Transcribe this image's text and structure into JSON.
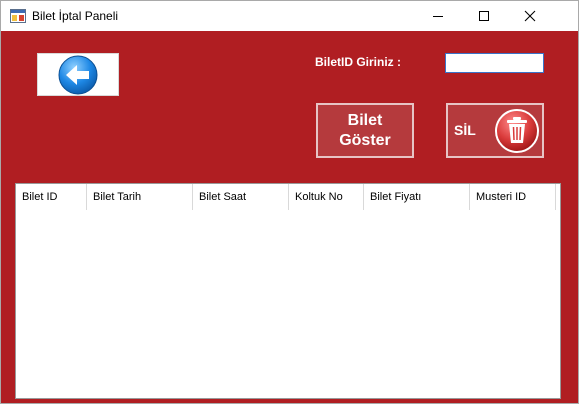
{
  "window": {
    "title": "Bilet İptal Paneli",
    "controls": {
      "minimize": "minimize",
      "maximize": "maximize",
      "close": "close"
    }
  },
  "form": {
    "id_label": "BiletID Giriniz :",
    "id_input_value": "",
    "show_button_label": "Bilet Göster",
    "delete_button_label": "SİL"
  },
  "table": {
    "columns": [
      "Bilet ID",
      "Bilet Tarih",
      "Bilet Saat",
      "Koltuk No",
      "Bilet Fiyatı",
      "Musteri ID"
    ],
    "rows": []
  },
  "colors": {
    "background": "#b01e22",
    "button_fill": "#b53a3d",
    "button_border": "#e7c4c5",
    "back_arrow": "#1e88e5",
    "trash": "#d93a3a"
  },
  "icons": {
    "app": "window-app-icon",
    "back": "back-arrow-icon",
    "delete": "trash-icon"
  }
}
